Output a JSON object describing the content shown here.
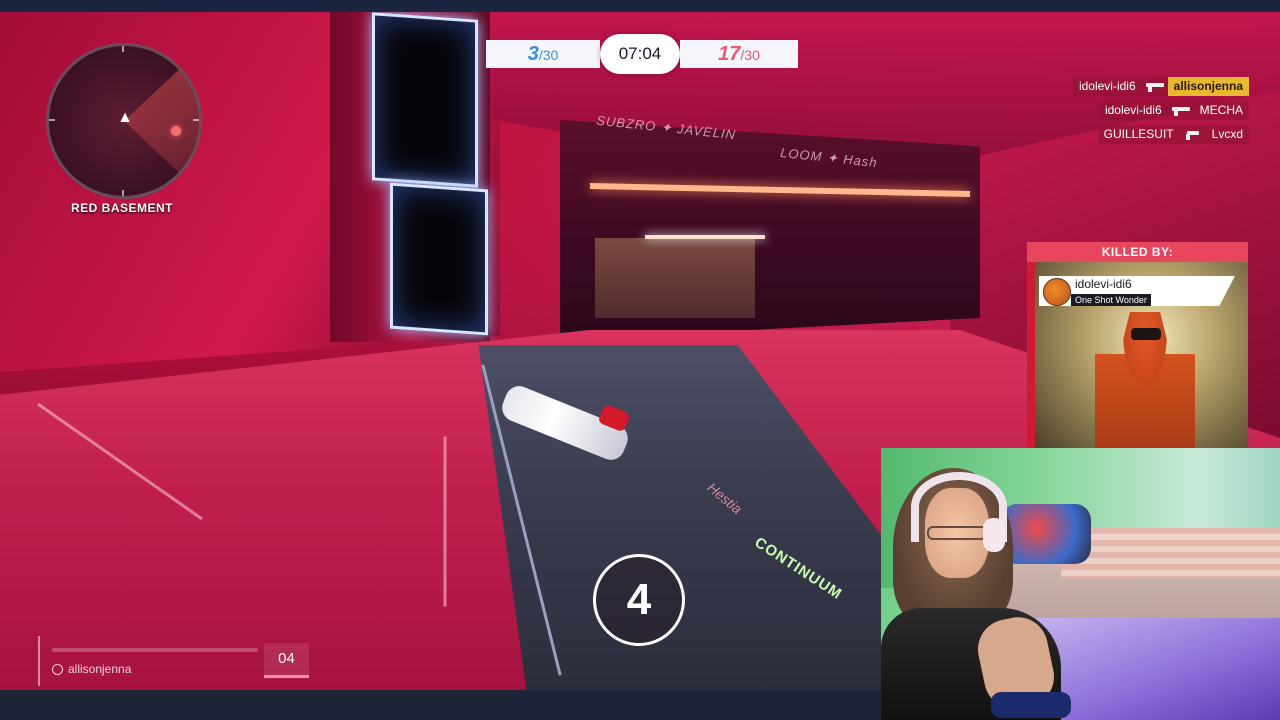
{
  "hud": {
    "location": "RED BASEMENT",
    "score_blue": {
      "value": "3",
      "max": "/30"
    },
    "timer": "07:04",
    "score_red": {
      "value": "17",
      "max": "/30"
    },
    "respawn_count": "4",
    "ability_value": "04",
    "chat_user": "allisonjenna"
  },
  "killfeed": [
    {
      "killer": "idolevi-idi6",
      "victim": "allisonjenna",
      "highlight": true,
      "weapon_icon": "rifle-icon"
    },
    {
      "killer": "idolevi-idi6",
      "victim": "MECHA",
      "highlight": false,
      "weapon_icon": "rifle-icon"
    },
    {
      "killer": "GUILLESUIT",
      "victim": "Lvcxd",
      "highlight": false,
      "weapon_icon": "pistol-icon"
    }
  ],
  "killed_by": {
    "header": "KILLED BY:",
    "name": "idolevi-idi6",
    "title": "One Shot Wonder"
  },
  "environment": {
    "wall_sign": "SUBZRO ✦ JAVELIN",
    "wall_sign2": "LOOM ✦ Hash",
    "ramp_text": "CONTINUUM",
    "ramp_text2": "Hestia"
  },
  "colors": {
    "blue_team": "#3a8ee6",
    "red_team": "#ef5675",
    "killfeed_highlight": "#e8b830",
    "killed_by_header": "#e8455e"
  }
}
